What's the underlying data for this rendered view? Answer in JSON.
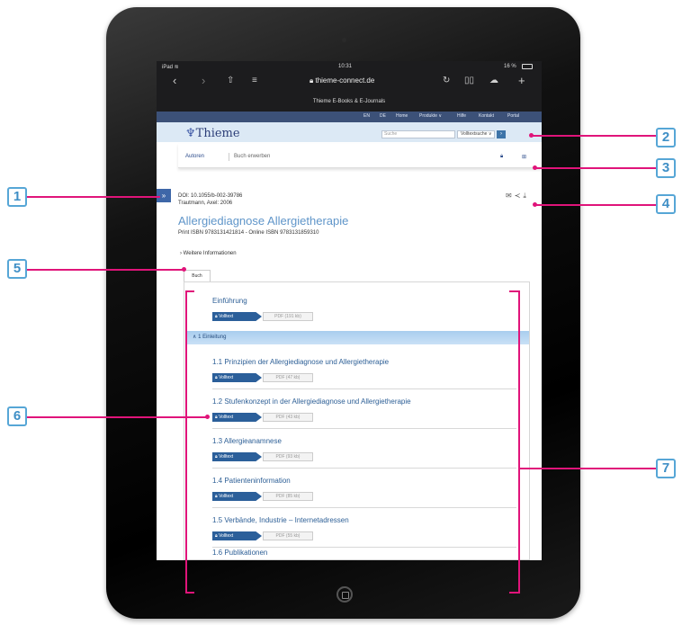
{
  "device": {
    "model": "iPad"
  },
  "statusbar": {
    "carrier": "iPad ≋",
    "time": "10:31",
    "battery": "16 %"
  },
  "browser": {
    "url": "thieme-connect.de",
    "tab_title": "Thieme E-Books & E-Journals",
    "icons": [
      "chevron-left-icon",
      "chevron-right-icon",
      "share-icon",
      "reader-icon",
      "lock-icon",
      "reload-icon",
      "bookmarks-icon",
      "cloud-icon",
      "new-tab-icon"
    ]
  },
  "site": {
    "top_links": [
      "EN",
      "DE",
      "Home",
      "Produkte ∨",
      "Hilfe",
      "Kontakt",
      "Portal"
    ],
    "logo_text": "Thieme",
    "search_placeholder": "Suche",
    "search_mode": "Volltextsuche",
    "subnav": [
      "Autoren",
      "Buch erwerben"
    ]
  },
  "doc": {
    "doi": "DOI: 10.1055/b-002-39786",
    "authors": "Trautmann, Axel: 2006",
    "title": "Allergiediagnose Allergietherapie",
    "isbn": "Print ISBN 9783131421814 - Online ISBN 9783131859310",
    "more_info": "Weitere Informationen",
    "tab": "Buch"
  },
  "toc": {
    "intro": {
      "title": "Einführung",
      "pdf": "PDF (191 kb)"
    },
    "section": "1 Einleitung",
    "volltext_label": "Volltext",
    "chapters": [
      {
        "title": "1.1 Prinzipien der Allergiediagnose und Allergietherapie",
        "pdf": "PDF (47 kb)"
      },
      {
        "title": "1.2 Stufenkonzept in der Allergiediagnose und Allergietherapie",
        "pdf": "PDF (43 kb)"
      },
      {
        "title": "1.3 Allergieanamnese",
        "pdf": "PDF (93 kb)"
      },
      {
        "title": "1.4 Patienteninformation",
        "pdf": "PDF (85 kb)"
      },
      {
        "title": "1.5 Verbände, Industrie – Internetadressen",
        "pdf": "PDF (55 kb)"
      },
      {
        "title": "1.6 Publikationen",
        "pdf": ""
      }
    ]
  },
  "callouts": [
    "1",
    "2",
    "3",
    "4",
    "5",
    "6",
    "7"
  ],
  "colors": {
    "accent": "#e0147a",
    "callout": "#56a6d6",
    "brand": "#2c3e78"
  }
}
